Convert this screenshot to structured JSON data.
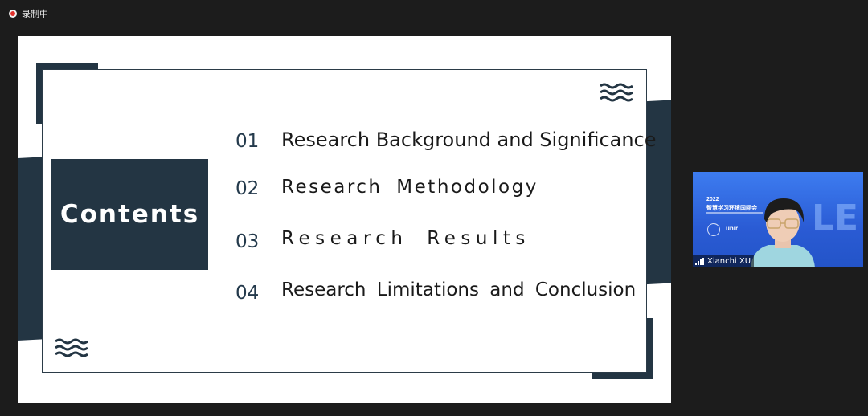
{
  "recording": {
    "label": "录制中"
  },
  "slide": {
    "heading": "Contents",
    "items": [
      {
        "number": "01",
        "label": "Research Background and Significance"
      },
      {
        "number": "02",
        "label": "Research Methodology"
      },
      {
        "number": "03",
        "label": "Research Results"
      },
      {
        "number": "04",
        "label": "Research Limitations and Conclusion"
      }
    ]
  },
  "participant": {
    "name": "Xianchi XU",
    "banner_year": "2022",
    "banner_title": "智慧学习环境国际会",
    "banner_logo": "unir",
    "banner_big": "LE"
  },
  "colors": {
    "accent": "#233543",
    "tile": "#2f64d8",
    "record": "#e0302b"
  }
}
